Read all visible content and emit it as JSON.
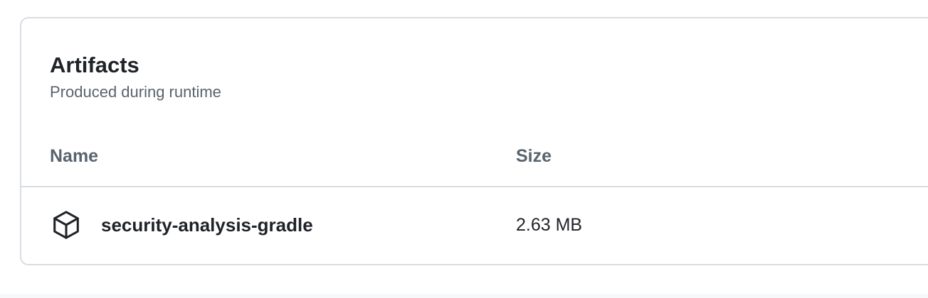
{
  "artifacts_panel": {
    "title": "Artifacts",
    "subtitle": "Produced during runtime",
    "columns": {
      "name": "Name",
      "size": "Size"
    },
    "rows": [
      {
        "icon": "package-icon",
        "name": "security-analysis-gradle",
        "size": "2.63 MB"
      }
    ]
  },
  "colors": {
    "text_primary": "#1f2328",
    "text_muted": "#59636e",
    "border": "#d8dde2",
    "background": "#ffffff"
  }
}
